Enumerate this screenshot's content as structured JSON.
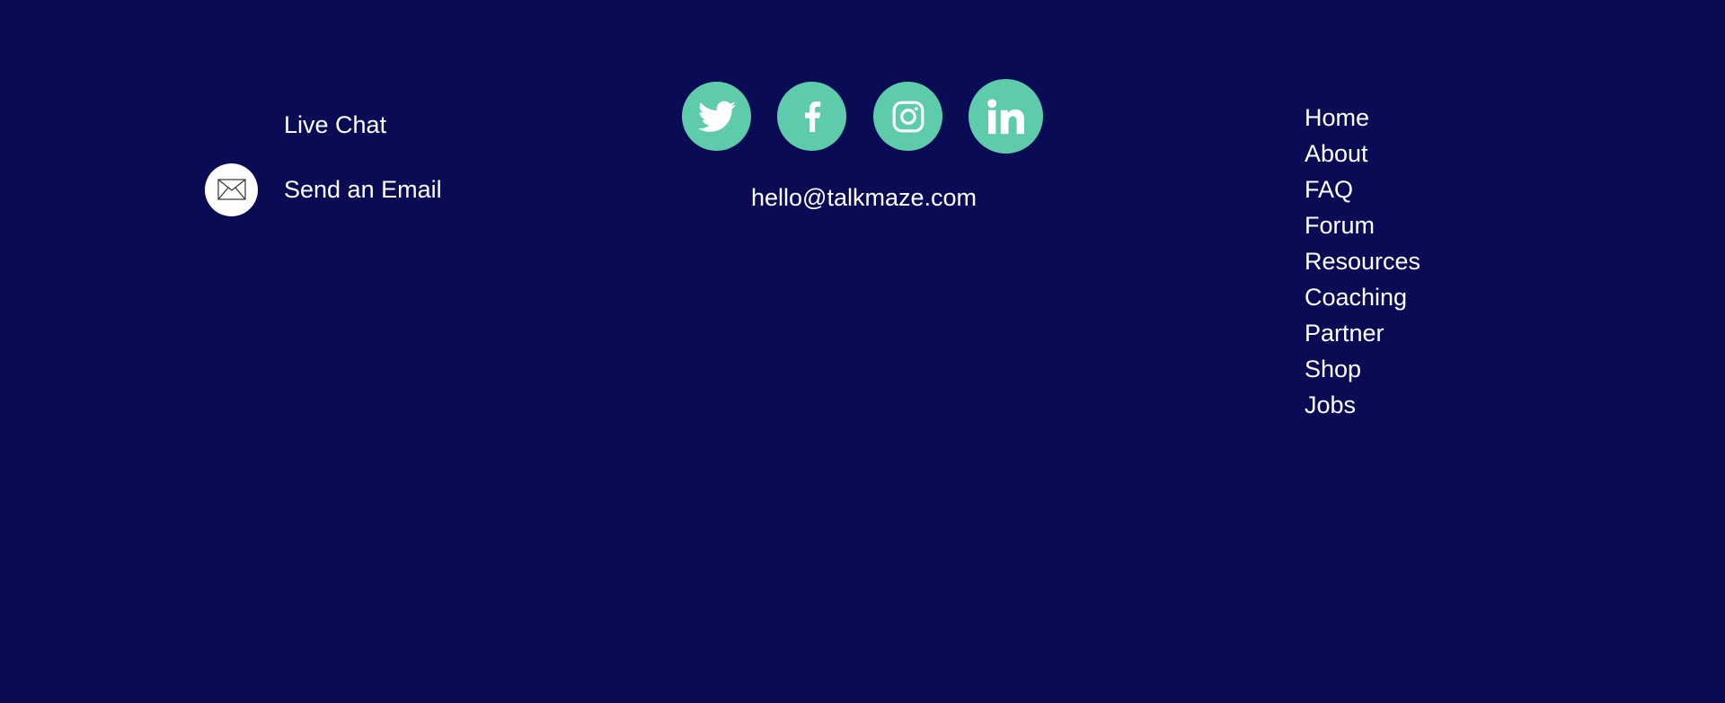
{
  "contact": {
    "live_chat_label": "Live Chat",
    "send_email_label": "Send an Email",
    "email_icon": "envelope-icon"
  },
  "social": {
    "icons": [
      "twitter-icon",
      "facebook-icon",
      "instagram-icon",
      "linkedin-icon"
    ],
    "email": "hello@talkmaze.com"
  },
  "nav": {
    "items": [
      "Home",
      "About",
      "FAQ",
      "Forum",
      "Resources",
      "Coaching",
      "Partner",
      "Shop",
      "Jobs"
    ]
  },
  "colors": {
    "background": "#0a0b55",
    "social_accent": "#5ecbaa",
    "text": "#ffffff"
  }
}
